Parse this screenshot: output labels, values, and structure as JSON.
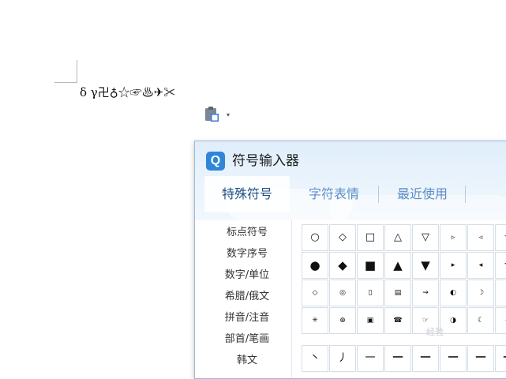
{
  "document": {
    "symbols_line": "δ γ卍♁☆☞♨✈✂"
  },
  "paste_options": {
    "arrow": "▾"
  },
  "symbol_window": {
    "logo_letter": "Q",
    "title": "符号输入器",
    "tabs": [
      {
        "label": "特殊符号",
        "active": true
      },
      {
        "label": "字符表情",
        "active": false
      },
      {
        "label": "最近使用",
        "active": false
      }
    ],
    "categories": [
      "标点符号",
      "数字序号",
      "数字/单位",
      "希腊/俄文",
      "拼音/注音",
      "部首/笔画",
      "韩文"
    ],
    "symbol_rows": [
      [
        "○",
        "◇",
        "□",
        "△",
        "▽",
        "▹",
        "◃",
        "☆"
      ],
      [
        "●",
        "◆",
        "■",
        "▲",
        "▼",
        "▸",
        "◂",
        "★"
      ],
      [
        "◇",
        "◎",
        "▯",
        "▤",
        "⇝",
        "◐",
        "☽",
        "♀"
      ],
      [
        "✳",
        "⊕",
        "▣",
        "☎",
        "☞",
        "◑",
        "☾",
        "♂"
      ]
    ],
    "stroke_row": [
      "丶",
      "丿",
      "一",
      "一",
      "一",
      "一",
      "一",
      "一"
    ]
  },
  "watermark": "经验"
}
